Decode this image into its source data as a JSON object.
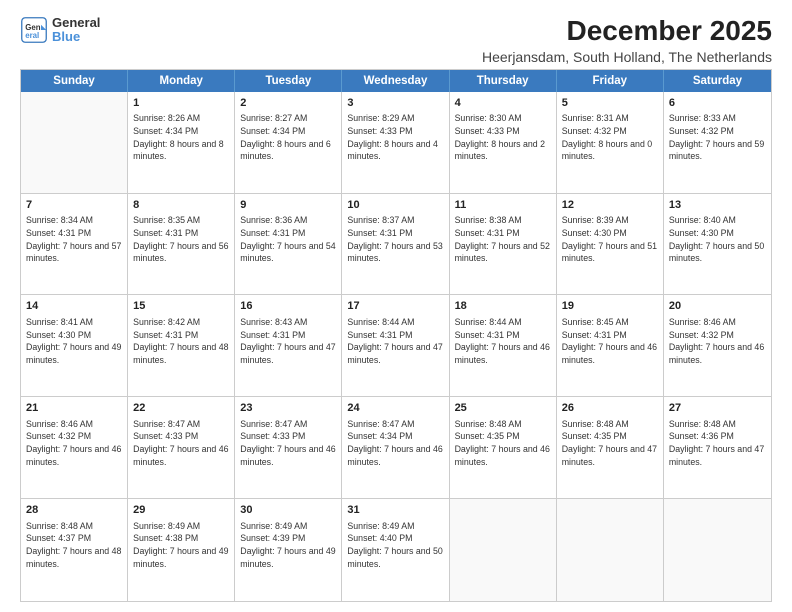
{
  "logo": {
    "line1": "General",
    "line2": "Blue"
  },
  "title": "December 2025",
  "subtitle": "Heerjansdam, South Holland, The Netherlands",
  "header_days": [
    "Sunday",
    "Monday",
    "Tuesday",
    "Wednesday",
    "Thursday",
    "Friday",
    "Saturday"
  ],
  "weeks": [
    [
      {
        "day": "",
        "sunrise": "",
        "sunset": "",
        "daylight": "",
        "empty": true
      },
      {
        "day": "1",
        "sunrise": "Sunrise: 8:26 AM",
        "sunset": "Sunset: 4:34 PM",
        "daylight": "Daylight: 8 hours and 8 minutes.",
        "empty": false
      },
      {
        "day": "2",
        "sunrise": "Sunrise: 8:27 AM",
        "sunset": "Sunset: 4:34 PM",
        "daylight": "Daylight: 8 hours and 6 minutes.",
        "empty": false
      },
      {
        "day": "3",
        "sunrise": "Sunrise: 8:29 AM",
        "sunset": "Sunset: 4:33 PM",
        "daylight": "Daylight: 8 hours and 4 minutes.",
        "empty": false
      },
      {
        "day": "4",
        "sunrise": "Sunrise: 8:30 AM",
        "sunset": "Sunset: 4:33 PM",
        "daylight": "Daylight: 8 hours and 2 minutes.",
        "empty": false
      },
      {
        "day": "5",
        "sunrise": "Sunrise: 8:31 AM",
        "sunset": "Sunset: 4:32 PM",
        "daylight": "Daylight: 8 hours and 0 minutes.",
        "empty": false
      },
      {
        "day": "6",
        "sunrise": "Sunrise: 8:33 AM",
        "sunset": "Sunset: 4:32 PM",
        "daylight": "Daylight: 7 hours and 59 minutes.",
        "empty": false
      }
    ],
    [
      {
        "day": "7",
        "sunrise": "Sunrise: 8:34 AM",
        "sunset": "Sunset: 4:31 PM",
        "daylight": "Daylight: 7 hours and 57 minutes.",
        "empty": false
      },
      {
        "day": "8",
        "sunrise": "Sunrise: 8:35 AM",
        "sunset": "Sunset: 4:31 PM",
        "daylight": "Daylight: 7 hours and 56 minutes.",
        "empty": false
      },
      {
        "day": "9",
        "sunrise": "Sunrise: 8:36 AM",
        "sunset": "Sunset: 4:31 PM",
        "daylight": "Daylight: 7 hours and 54 minutes.",
        "empty": false
      },
      {
        "day": "10",
        "sunrise": "Sunrise: 8:37 AM",
        "sunset": "Sunset: 4:31 PM",
        "daylight": "Daylight: 7 hours and 53 minutes.",
        "empty": false
      },
      {
        "day": "11",
        "sunrise": "Sunrise: 8:38 AM",
        "sunset": "Sunset: 4:31 PM",
        "daylight": "Daylight: 7 hours and 52 minutes.",
        "empty": false
      },
      {
        "day": "12",
        "sunrise": "Sunrise: 8:39 AM",
        "sunset": "Sunset: 4:30 PM",
        "daylight": "Daylight: 7 hours and 51 minutes.",
        "empty": false
      },
      {
        "day": "13",
        "sunrise": "Sunrise: 8:40 AM",
        "sunset": "Sunset: 4:30 PM",
        "daylight": "Daylight: 7 hours and 50 minutes.",
        "empty": false
      }
    ],
    [
      {
        "day": "14",
        "sunrise": "Sunrise: 8:41 AM",
        "sunset": "Sunset: 4:30 PM",
        "daylight": "Daylight: 7 hours and 49 minutes.",
        "empty": false
      },
      {
        "day": "15",
        "sunrise": "Sunrise: 8:42 AM",
        "sunset": "Sunset: 4:31 PM",
        "daylight": "Daylight: 7 hours and 48 minutes.",
        "empty": false
      },
      {
        "day": "16",
        "sunrise": "Sunrise: 8:43 AM",
        "sunset": "Sunset: 4:31 PM",
        "daylight": "Daylight: 7 hours and 47 minutes.",
        "empty": false
      },
      {
        "day": "17",
        "sunrise": "Sunrise: 8:44 AM",
        "sunset": "Sunset: 4:31 PM",
        "daylight": "Daylight: 7 hours and 47 minutes.",
        "empty": false
      },
      {
        "day": "18",
        "sunrise": "Sunrise: 8:44 AM",
        "sunset": "Sunset: 4:31 PM",
        "daylight": "Daylight: 7 hours and 46 minutes.",
        "empty": false
      },
      {
        "day": "19",
        "sunrise": "Sunrise: 8:45 AM",
        "sunset": "Sunset: 4:31 PM",
        "daylight": "Daylight: 7 hours and 46 minutes.",
        "empty": false
      },
      {
        "day": "20",
        "sunrise": "Sunrise: 8:46 AM",
        "sunset": "Sunset: 4:32 PM",
        "daylight": "Daylight: 7 hours and 46 minutes.",
        "empty": false
      }
    ],
    [
      {
        "day": "21",
        "sunrise": "Sunrise: 8:46 AM",
        "sunset": "Sunset: 4:32 PM",
        "daylight": "Daylight: 7 hours and 46 minutes.",
        "empty": false
      },
      {
        "day": "22",
        "sunrise": "Sunrise: 8:47 AM",
        "sunset": "Sunset: 4:33 PM",
        "daylight": "Daylight: 7 hours and 46 minutes.",
        "empty": false
      },
      {
        "day": "23",
        "sunrise": "Sunrise: 8:47 AM",
        "sunset": "Sunset: 4:33 PM",
        "daylight": "Daylight: 7 hours and 46 minutes.",
        "empty": false
      },
      {
        "day": "24",
        "sunrise": "Sunrise: 8:47 AM",
        "sunset": "Sunset: 4:34 PM",
        "daylight": "Daylight: 7 hours and 46 minutes.",
        "empty": false
      },
      {
        "day": "25",
        "sunrise": "Sunrise: 8:48 AM",
        "sunset": "Sunset: 4:35 PM",
        "daylight": "Daylight: 7 hours and 46 minutes.",
        "empty": false
      },
      {
        "day": "26",
        "sunrise": "Sunrise: 8:48 AM",
        "sunset": "Sunset: 4:35 PM",
        "daylight": "Daylight: 7 hours and 47 minutes.",
        "empty": false
      },
      {
        "day": "27",
        "sunrise": "Sunrise: 8:48 AM",
        "sunset": "Sunset: 4:36 PM",
        "daylight": "Daylight: 7 hours and 47 minutes.",
        "empty": false
      }
    ],
    [
      {
        "day": "28",
        "sunrise": "Sunrise: 8:48 AM",
        "sunset": "Sunset: 4:37 PM",
        "daylight": "Daylight: 7 hours and 48 minutes.",
        "empty": false
      },
      {
        "day": "29",
        "sunrise": "Sunrise: 8:49 AM",
        "sunset": "Sunset: 4:38 PM",
        "daylight": "Daylight: 7 hours and 49 minutes.",
        "empty": false
      },
      {
        "day": "30",
        "sunrise": "Sunrise: 8:49 AM",
        "sunset": "Sunset: 4:39 PM",
        "daylight": "Daylight: 7 hours and 49 minutes.",
        "empty": false
      },
      {
        "day": "31",
        "sunrise": "Sunrise: 8:49 AM",
        "sunset": "Sunset: 4:40 PM",
        "daylight": "Daylight: 7 hours and 50 minutes.",
        "empty": false
      },
      {
        "day": "",
        "sunrise": "",
        "sunset": "",
        "daylight": "",
        "empty": true
      },
      {
        "day": "",
        "sunrise": "",
        "sunset": "",
        "daylight": "",
        "empty": true
      },
      {
        "day": "",
        "sunrise": "",
        "sunset": "",
        "daylight": "",
        "empty": true
      }
    ]
  ]
}
